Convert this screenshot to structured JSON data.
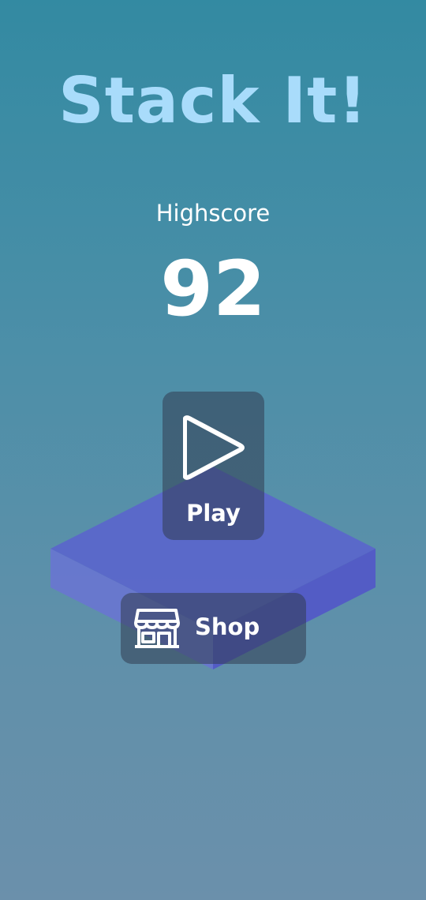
{
  "app": {
    "title": "Stack It!"
  },
  "highscore": {
    "label": "Highscore",
    "value": "92"
  },
  "menu": {
    "play_label": "Play",
    "shop_label": "Shop"
  },
  "icons": {
    "play": "play-icon",
    "shop": "shop-icon"
  },
  "colors": {
    "title": "#a9dcfb",
    "block_top": "#5a63cf",
    "block_left": "#6a74d4",
    "block_right": "#5257c8"
  }
}
